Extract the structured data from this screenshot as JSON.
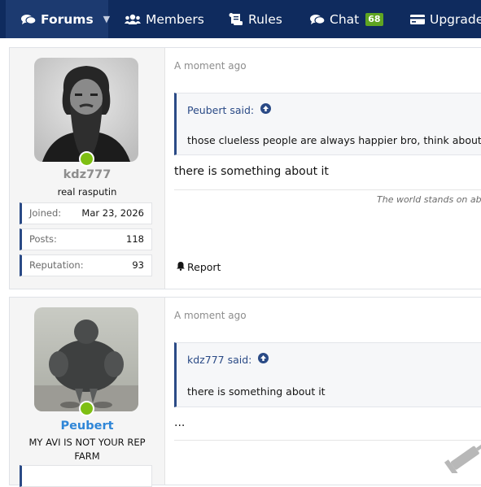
{
  "nav": {
    "items": [
      {
        "label": "Forums",
        "icon": "comments-icon",
        "active": true,
        "has_dropdown": true
      },
      {
        "label": "Members",
        "icon": "users-icon"
      },
      {
        "label": "Rules",
        "icon": "scroll-icon"
      },
      {
        "label": "Chat",
        "icon": "chat-icon",
        "badge": "68"
      },
      {
        "label": "Upgrade",
        "icon": "credit-card-icon"
      }
    ]
  },
  "posts": [
    {
      "user": {
        "name": "kdz777",
        "name_color": "#8d8d8d",
        "title": "real rasputin",
        "online": true,
        "stats": [
          {
            "label": "Joined:",
            "value": "Mar 23, 2026"
          },
          {
            "label": "Posts:",
            "value": "118"
          },
          {
            "label": "Reputation:",
            "value": "93"
          }
        ]
      },
      "date": "A moment ago",
      "quote": {
        "author": "Peubert said:",
        "text": "those clueless people are always happier bro, think about it"
      },
      "content": "there is something about it",
      "signature": "The world stands on absu",
      "report_label": "Report"
    },
    {
      "user": {
        "name": "Peubert",
        "name_color": "#2f86d7",
        "title": "MY AVI IS NOT YOUR REP FARM",
        "online": true
      },
      "date": "A moment ago",
      "quote": {
        "author": "kdz777 said:",
        "text": "there is something about it"
      },
      "content": "..."
    }
  ],
  "colors": {
    "nav_bg": "#0f2b5e",
    "accent": "#2a4a86",
    "online": "#7ebf12",
    "badge": "#5fa521"
  }
}
